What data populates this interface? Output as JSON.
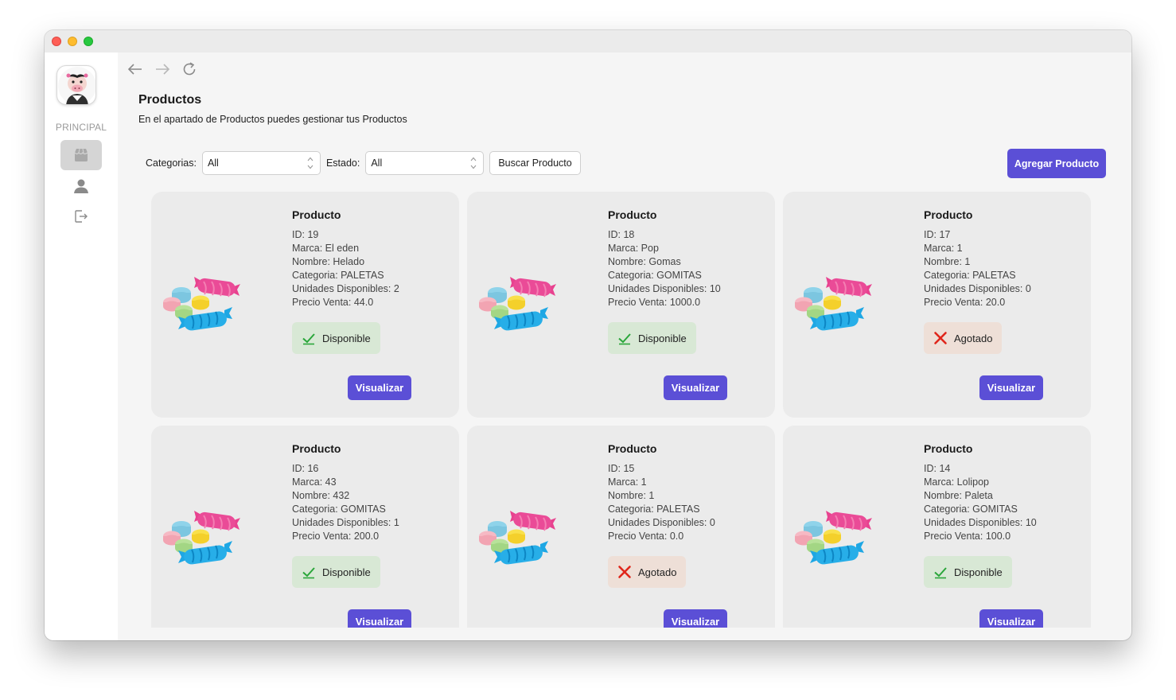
{
  "sidebar": {
    "section_label": "PRINCIPAL",
    "items": [
      {
        "icon": "store-icon",
        "active": true
      },
      {
        "icon": "user-icon",
        "active": false
      },
      {
        "icon": "logout-icon",
        "active": false
      }
    ]
  },
  "header": {
    "title": "Productos",
    "subtitle": "En el apartado de Productos puedes gestionar tus Productos"
  },
  "filters": {
    "category_label": "Categorias:",
    "category_value": "All",
    "status_label": "Estado:",
    "status_value": "All",
    "search_button": "Buscar Producto",
    "add_button": "Agregar Producto"
  },
  "colors": {
    "accent": "#5b4fd6",
    "available_bg": "#d8e8d5",
    "soldout_bg": "#eedfd7",
    "check": "#2aa63a",
    "cross": "#e0261b"
  },
  "products": [
    {
      "title": "Producto",
      "id": "ID: 19",
      "marca": "Marca: El eden",
      "nombre": "Nombre: Helado",
      "categoria": "Categoria: PALETAS",
      "unidades": "Unidades Disponibles: 2",
      "precio": "Precio Venta: 44.0",
      "status": "Disponible",
      "available": true,
      "action": "Visualizar"
    },
    {
      "title": "Producto",
      "id": "ID: 18",
      "marca": "Marca: Pop",
      "nombre": "Nombre: Gomas",
      "categoria": "Categoria: GOMITAS",
      "unidades": "Unidades Disponibles: 10",
      "precio": "Precio Venta: 1000.0",
      "status": "Disponible",
      "available": true,
      "action": "Visualizar"
    },
    {
      "title": "Producto",
      "id": "ID: 17",
      "marca": "Marca: 1",
      "nombre": "Nombre: 1",
      "categoria": "Categoria: PALETAS",
      "unidades": "Unidades Disponibles: 0",
      "precio": "Precio Venta: 20.0",
      "status": "Agotado",
      "available": false,
      "action": "Visualizar"
    },
    {
      "title": "Producto",
      "id": "ID: 16",
      "marca": "Marca: 43",
      "nombre": "Nombre: 432",
      "categoria": "Categoria: GOMITAS",
      "unidades": "Unidades Disponibles: 1",
      "precio": "Precio Venta: 200.0",
      "status": "Disponible",
      "available": true,
      "action": "Visualizar"
    },
    {
      "title": "Producto",
      "id": "ID: 15",
      "marca": "Marca: 1",
      "nombre": "Nombre: 1",
      "categoria": "Categoria: PALETAS",
      "unidades": "Unidades Disponibles: 0",
      "precio": "Precio Venta: 0.0",
      "status": "Agotado",
      "available": false,
      "action": "Visualizar"
    },
    {
      "title": "Producto",
      "id": "ID: 14",
      "marca": "Marca: Lolipop",
      "nombre": "Nombre: Paleta",
      "categoria": "Categoria: GOMITAS",
      "unidades": "Unidades Disponibles: 10",
      "precio": "Precio Venta: 100.0",
      "status": "Disponible",
      "available": true,
      "action": "Visualizar"
    }
  ]
}
